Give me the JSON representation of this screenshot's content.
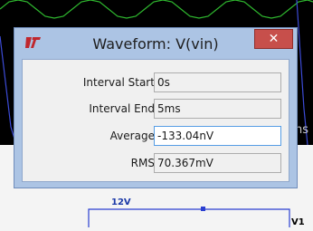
{
  "window": {
    "title": "Waveform: V(vin)",
    "close_label": "✕"
  },
  "fields": [
    {
      "label": "Interval Start:",
      "value": "0s"
    },
    {
      "label": "Interval End:",
      "value": "5ms"
    },
    {
      "label": "Average:",
      "value": "-133.04nV"
    },
    {
      "label": "RMS:",
      "value": "70.367mV"
    }
  ],
  "background": {
    "plot_partial_text": "ns",
    "net_label": "12V",
    "component_ref": "V1"
  },
  "colors": {
    "dialog_frame": "#acc4e4",
    "close_button": "#c74f4b",
    "trace_green": "#2fb82f",
    "trace_blue": "#3c4bd6",
    "schematic_wire": "#2a3fd1"
  }
}
